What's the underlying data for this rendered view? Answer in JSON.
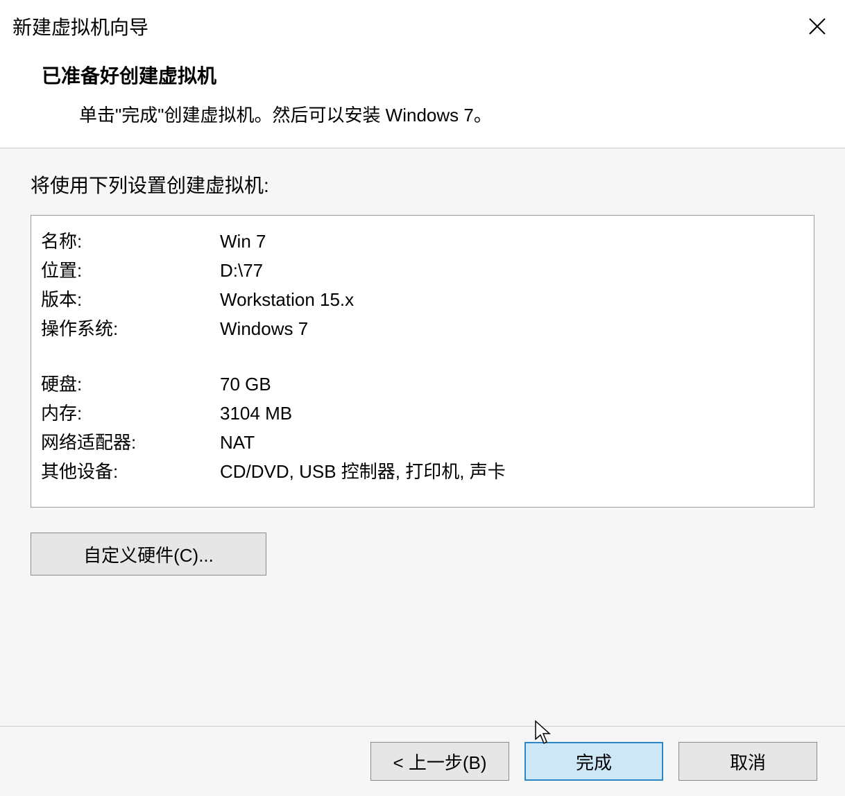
{
  "titlebar": {
    "title": "新建虚拟机向导"
  },
  "header": {
    "title": "已准备好创建虚拟机",
    "subtitle": "单击\"完成\"创建虚拟机。然后可以安装 Windows 7。"
  },
  "content": {
    "summary_label": "将使用下列设置创建虚拟机:",
    "rows": {
      "name_label": "名称:",
      "name_value": "Win 7",
      "location_label": "位置:",
      "location_value": "D:\\77",
      "version_label": "版本:",
      "version_value": "Workstation 15.x",
      "os_label": "操作系统:",
      "os_value": "Windows 7",
      "disk_label": "硬盘:",
      "disk_value": "70 GB",
      "memory_label": "内存:",
      "memory_value": "3104 MB",
      "network_label": "网络适配器:",
      "network_value": "NAT",
      "other_label": "其他设备:",
      "other_value": "CD/DVD, USB 控制器, 打印机, 声卡"
    },
    "customize_button": "自定义硬件(C)..."
  },
  "footer": {
    "back": "< 上一步(B)",
    "finish": "完成",
    "cancel": "取消"
  }
}
